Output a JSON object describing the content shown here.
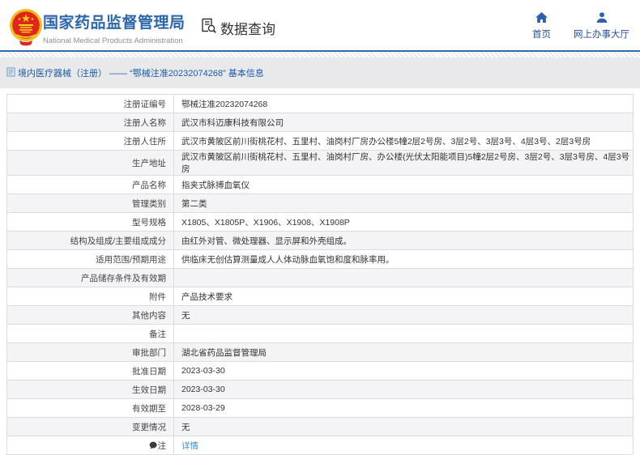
{
  "header": {
    "org_name": "国家药品监督管理局",
    "org_name_en": "National Medical Products Administration",
    "section_title": "数据查询",
    "nav": [
      {
        "label": "首页",
        "icon": "home-icon"
      },
      {
        "label": "网上办事大厅",
        "icon": "user-icon"
      }
    ]
  },
  "breadcrumb": {
    "text": "境内医疗器械（注册） —— “鄂械注准20232074268” 基本信息"
  },
  "table": {
    "rows": [
      {
        "label": "注册证编号",
        "value": "鄂械注准20232074268"
      },
      {
        "label": "注册人名称",
        "value": "武汉市科迈康科技有限公司"
      },
      {
        "label": "注册人住所",
        "value": "武汉市黄陂区前川街桃花村、五里村、油岗村厂房办公楼5幢2层2号房、3层2号、3层3号、4层3号、2层3号房"
      },
      {
        "label": "生产地址",
        "value": "武汉市黄陂区前川街桃花村、五里村、油岗村厂房、办公楼(光伏太阳能项目)5幢2层2号房、3层2号、3层3号房、4层3号房"
      },
      {
        "label": "产品名称",
        "value": "指夹式脉搏血氧仪"
      },
      {
        "label": "管理类别",
        "value": "第二类"
      },
      {
        "label": "型号规格",
        "value": "X1805、X1805P、X1906、X1908、X1908P"
      },
      {
        "label": "结构及组成/主要组成成分",
        "value": "由红外对管、微处理器、显示屏和外壳组成。"
      },
      {
        "label": "适用范围/预期用途",
        "value": "供临床无创估算测量成人人体动脉血氧饱和度和脉率用。"
      },
      {
        "label": "产品储存条件及有效期",
        "value": ""
      },
      {
        "label": "附件",
        "value": "产品技术要求"
      },
      {
        "label": "其他内容",
        "value": "无"
      },
      {
        "label": "备注",
        "value": ""
      },
      {
        "label": "审批部门",
        "value": "湖北省药品监督管理局"
      },
      {
        "label": "批准日期",
        "value": "2023-03-30"
      },
      {
        "label": "生效日期",
        "value": "2023-03-30"
      },
      {
        "label": "有效期至",
        "value": "2028-03-29"
      },
      {
        "label": "变更情况",
        "value": "无"
      },
      {
        "label": "注",
        "value": "详情",
        "value_is_link": true,
        "label_icon": "note-icon"
      }
    ]
  },
  "colors": {
    "accent_blue": "#2b66ad",
    "link_blue": "#3e8ddd",
    "breadcrumb_text": "#1a5aa8",
    "stripe": "#f4f4f6"
  }
}
